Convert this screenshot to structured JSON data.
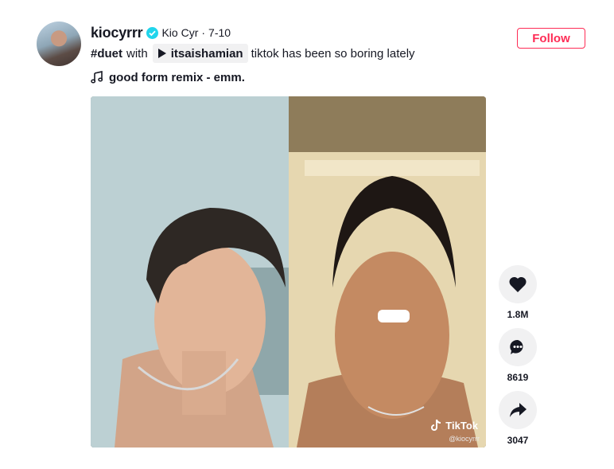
{
  "author": {
    "username": "kiocyrrr",
    "nickname": "Kio Cyr",
    "separator": "·",
    "date": "7-10",
    "follow_label": "Follow"
  },
  "caption": {
    "hashtag": "#duet",
    "with": "with",
    "mention": "itsaishamian",
    "text": "tiktok has been so boring lately"
  },
  "music": {
    "title": "good form remix - emm."
  },
  "video": {
    "watermark": "TikTok",
    "watermark_handle": "@kiocyrrr"
  },
  "actions": {
    "likes": "1.8M",
    "comments": "8619",
    "shares": "3047"
  },
  "colors": {
    "accent": "#fe2c55",
    "verified": "#20d5ec",
    "button_bg": "#f1f1f2"
  }
}
